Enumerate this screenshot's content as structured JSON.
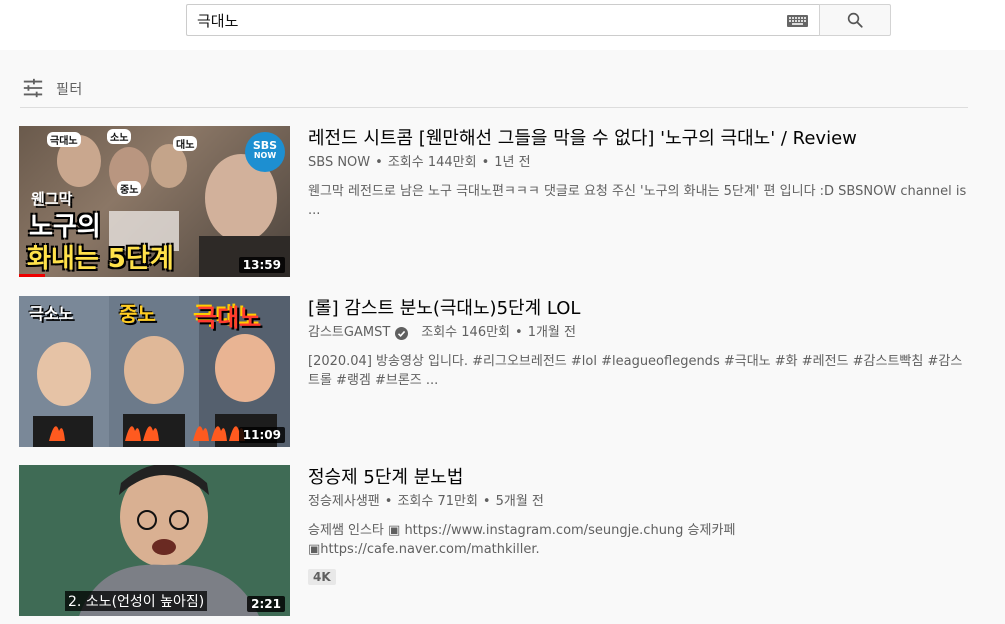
{
  "search": {
    "query": "극대노"
  },
  "filter": {
    "label": "필터"
  },
  "results": [
    {
      "title": "레전드 시트콤 [웬만해선 그들을 막을 수 없다] '노구의 극대노' / Review",
      "channel": "SBS NOW",
      "views": "조회수 144만회",
      "age": "1년 전",
      "description": "웬그막 레전드로 남은 노구 극대노편ㅋㅋㅋ 댓글로 요청 주신 '노구의 화내는 5단계' 편 입니다 :D SBSNOW channel is ...",
      "duration": "13:59",
      "thumb": {
        "tag1": "극대노",
        "tag2": "소노",
        "tag3": "대노",
        "tag4": "중노",
        "line1": "웬그막",
        "line2": "노구의",
        "line3": "화내는 5단계",
        "logo_top": "SBS",
        "logo_bottom": "NOW"
      }
    },
    {
      "title": "[롤] 감스트 분노(극대노)5단계 LOL",
      "channel": "감스트GAMST",
      "views": "조회수 146만회",
      "age": "1개월 전",
      "description": "[2020.04] 방송영상 입니다. #리그오브레전드 #lol #leagueoflegends #극대노 #화 #레전드 #감스트빡침 #감스트롤 #랭겜 #브론즈 ...",
      "duration": "11:09",
      "thumb": {
        "label1": "극소노",
        "label2": "중노",
        "label3": "극대노"
      }
    },
    {
      "title": "정승제 5단계 분노법",
      "channel": "정승제사생팬",
      "views": "조회수 71만회",
      "age": "5개월 전",
      "description": "승제쌤 인스타 ▣ https://www.instagram.com/seungje.chung 승제카페 ▣https://cafe.naver.com/mathkiller.",
      "badge": "4K",
      "duration": "2:21",
      "thumb": {
        "subtitle": "2. 소노(언성이 높아짐)"
      }
    }
  ]
}
